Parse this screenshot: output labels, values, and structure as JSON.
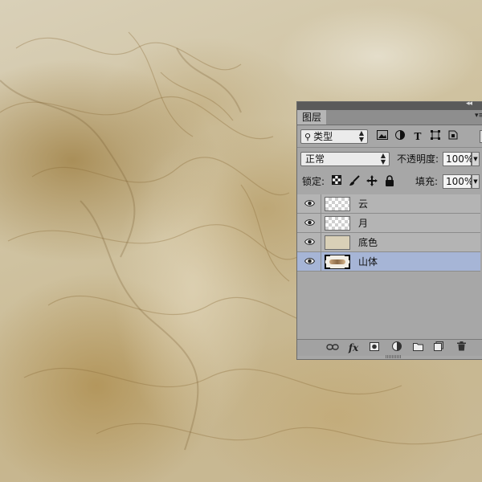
{
  "panel": {
    "title": "图层",
    "collapse_glyph": "◂◂",
    "menu_glyph": "▾≡"
  },
  "filter": {
    "label": "类型",
    "icons": [
      "image-filter-icon",
      "adjustment-filter-icon",
      "text-filter-icon",
      "shape-filter-icon",
      "smart-object-filter-icon"
    ]
  },
  "blend": {
    "mode": "正常",
    "opacity_label": "不透明度:",
    "opacity_value": "100%"
  },
  "lock": {
    "label": "锁定:",
    "fill_label": "填充:",
    "fill_value": "100%"
  },
  "layers": [
    {
      "name": "云",
      "thumbnail": "transparent",
      "visible": true,
      "selected": false
    },
    {
      "name": "月",
      "thumbnail": "transparent",
      "visible": true,
      "selected": false
    },
    {
      "name": "底色",
      "thumbnail": "solid",
      "visible": true,
      "selected": false
    },
    {
      "name": "山体",
      "thumbnail": "image",
      "visible": true,
      "selected": true
    }
  ],
  "bottom_icons": [
    "link-layers-icon",
    "fx-icon",
    "add-mask-icon",
    "adjustment-layer-icon",
    "new-group-icon",
    "new-layer-icon",
    "delete-layer-icon"
  ],
  "colors": {
    "panel_bg": "#a7a7a7",
    "selected_row": "#a6b5d6",
    "canvas_tone": "#cfc2a0"
  }
}
